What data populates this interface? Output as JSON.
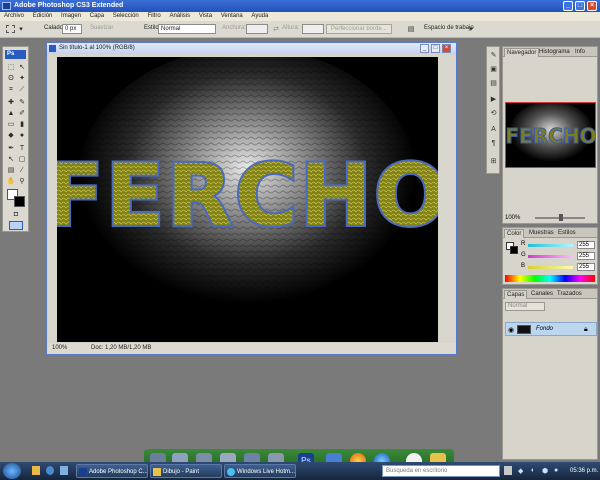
{
  "app": {
    "title": "Adobe Photoshop CS3 Extended",
    "menu": [
      "Archivo",
      "Edición",
      "Imagen",
      "Capa",
      "Selección",
      "Filtro",
      "Análisis",
      "Vista",
      "Ventana",
      "Ayuda"
    ]
  },
  "options_bar": {
    "feather_label": "Calado:",
    "feather_value": "0 px",
    "antialias_label": "Suavizar",
    "style_label": "Estilo:",
    "style_value": "Normal",
    "width_label": "Anchura:",
    "height_label": "Altura:",
    "refine_button": "Perfeccionar borde...",
    "workspace_label": "Espacio de trabajo"
  },
  "document": {
    "title": "Sin título-1 al 100% (RGB/8)",
    "canvas_text": "FERCHO",
    "zoom": "100%",
    "doc_info": "Doc: 1,20 MB/1,20 MB"
  },
  "navigator": {
    "tabs": [
      "Navegador",
      "Histograma",
      "Info"
    ],
    "preview_text": "FERCHO",
    "zoom": "100%"
  },
  "color": {
    "tabs": [
      "Color",
      "Muestras",
      "Estilos"
    ],
    "channels": [
      {
        "label": "R",
        "value": "255",
        "color": "#4fd6e8"
      },
      {
        "label": "G",
        "value": "255",
        "color": "#e066d6"
      },
      {
        "label": "B",
        "value": "255",
        "color": "#e8e35a"
      }
    ]
  },
  "layers": {
    "tabs": [
      "Capas",
      "Canales",
      "Trazados"
    ],
    "blend_mode": "Normal",
    "items": [
      {
        "name": "Fondo"
      }
    ]
  },
  "taskbar": {
    "items": [
      {
        "label": "Adobe Photoshop C..."
      },
      {
        "label": "Dibujo - Paint"
      },
      {
        "label": "Windows Live Hotm..."
      }
    ],
    "search_placeholder": "Búsqueda en escritorio",
    "clock": "05:36 p.m."
  },
  "colors": {
    "title_bar": "#2452b8",
    "canvas_bg": "#000000",
    "text_fill": "#8a8a1a",
    "text_outline": "#2f4f9a"
  }
}
